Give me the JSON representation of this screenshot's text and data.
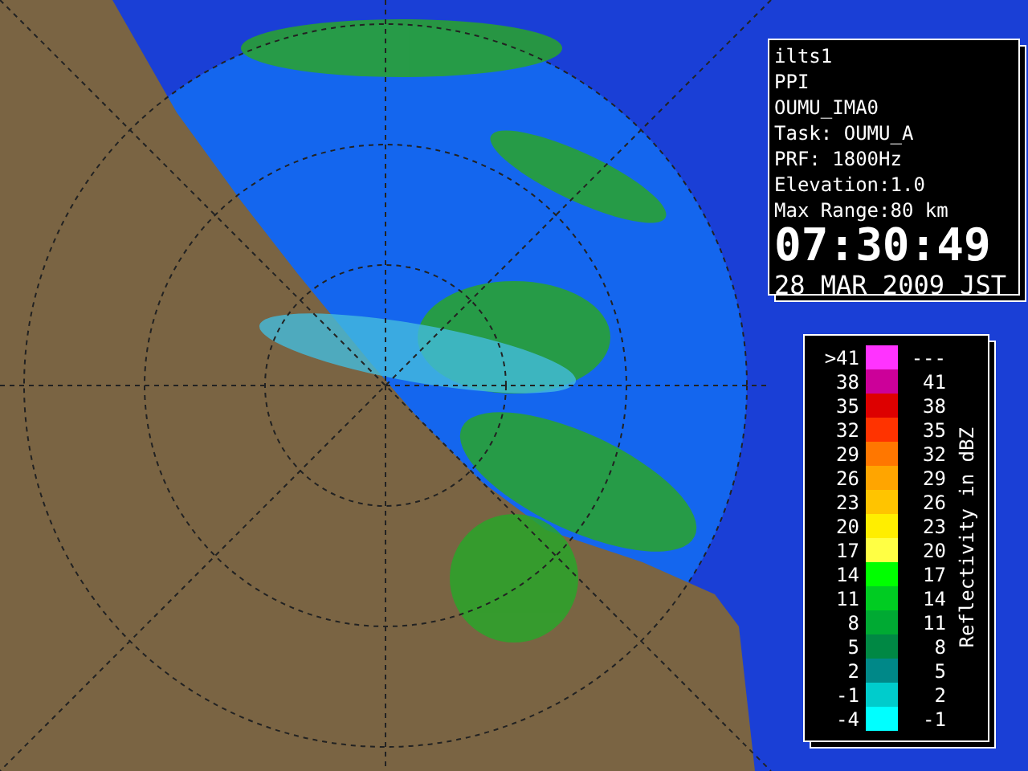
{
  "info_panel": {
    "lines": [
      "ilts1",
      "PPI",
      "OUMU_IMA0",
      "Task: OUMU_A",
      "PRF: 1800Hz",
      "Elevation:1.0",
      "Max Range:80 km"
    ],
    "time": "07:30:49",
    "date": "28 MAR 2009 JST"
  },
  "legend": {
    "title": "Reflectivity in dBZ",
    "rows": [
      {
        "low": ">41",
        "high": "---",
        "color": "#ff33ff"
      },
      {
        "low": "38",
        "high": "41",
        "color": "#cc0099"
      },
      {
        "low": "35",
        "high": "38",
        "color": "#dd0000"
      },
      {
        "low": "32",
        "high": "35",
        "color": "#ff3300"
      },
      {
        "low": "29",
        "high": "32",
        "color": "#ff7700"
      },
      {
        "low": "26",
        "high": "29",
        "color": "#ffa500"
      },
      {
        "low": "23",
        "high": "26",
        "color": "#ffc400"
      },
      {
        "low": "20",
        "high": "23",
        "color": "#ffee00"
      },
      {
        "low": "17",
        "high": "20",
        "color": "#ffff44"
      },
      {
        "low": "14",
        "high": "17",
        "color": "#00ff00"
      },
      {
        "low": "11",
        "high": "14",
        "color": "#00cc22"
      },
      {
        "low": "8",
        "high": "11",
        "color": "#00aa33"
      },
      {
        "low": "5",
        "high": "8",
        "color": "#008844"
      },
      {
        "low": "2",
        "high": "5",
        "color": "#008888"
      },
      {
        "low": "-1",
        "high": "2",
        "color": "#00cccc"
      },
      {
        "low": "-4",
        "high": "-1",
        "color": "#00ffff"
      }
    ]
  }
}
